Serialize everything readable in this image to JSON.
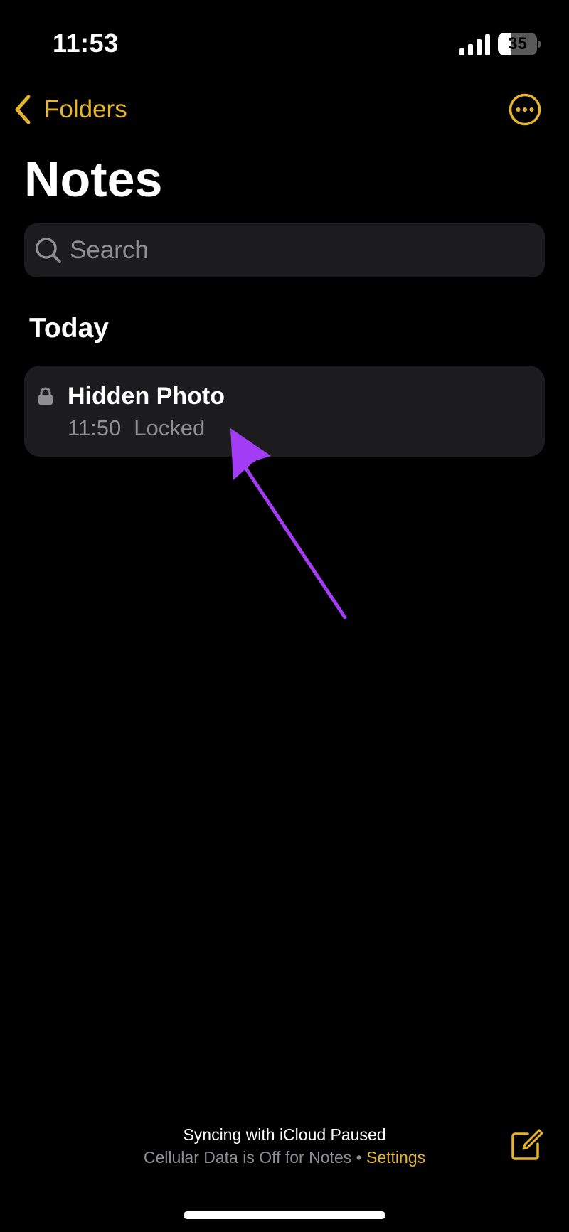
{
  "status_bar": {
    "time": "11:53",
    "battery_level": "35",
    "battery_fraction": 0.35
  },
  "nav": {
    "back_label": "Folders",
    "title": "Notes"
  },
  "search": {
    "placeholder": "Search"
  },
  "sections": [
    {
      "header": "Today",
      "notes": [
        {
          "title": "Hidden Photo",
          "time": "11:50",
          "status": "Locked",
          "icon": "lock-icon"
        }
      ]
    }
  ],
  "annotation": {
    "arrow_color": "#a23cf5"
  },
  "footer": {
    "sync_title": "Syncing with iCloud Paused",
    "sync_sub": "Cellular Data is Off for Notes",
    "separator": "•",
    "settings_link": "Settings"
  },
  "colors": {
    "accent": "#e6b52e",
    "background": "#000000",
    "card": "#1c1c1e",
    "secondary_text": "#8e8e93"
  }
}
